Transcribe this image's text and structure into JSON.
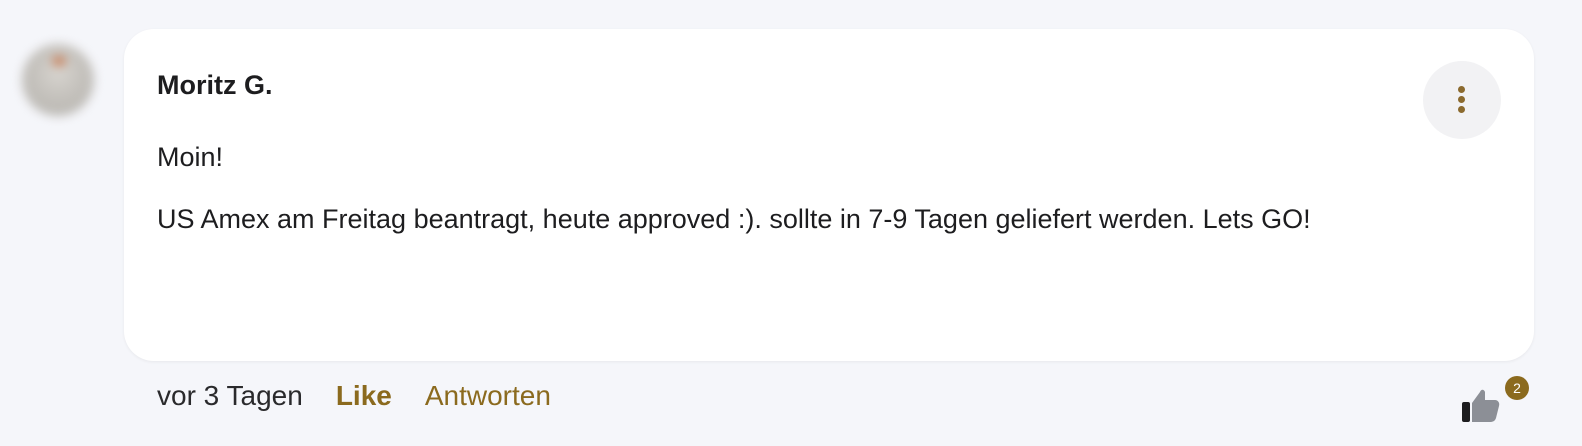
{
  "comment": {
    "author": "Moritz G.",
    "paragraphs": [
      "Moin!",
      "US Amex am Freitag beantragt, heute approved :). sollte in 7-9 Tagen geliefert werden. Lets GO!"
    ],
    "timestamp": "vor 3 Tagen",
    "like_label": "Like",
    "reply_label": "Antworten",
    "reaction_count": "2",
    "reaction_icon": "thumbs-up-icon",
    "menu_icon": "vertical-dots-icon",
    "accent_color": "#8b6a1e"
  }
}
